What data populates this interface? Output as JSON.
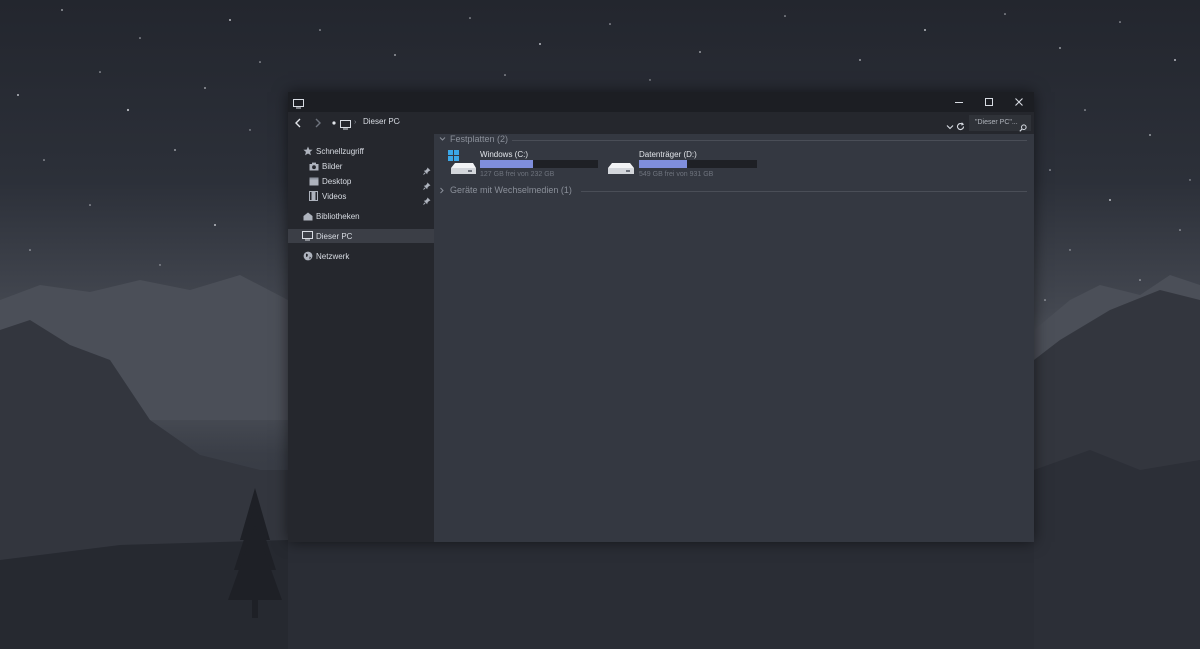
{
  "window": {
    "accent_color": "#7f8edc"
  },
  "address": {
    "breadcrumb": "Dieser PC",
    "search_placeholder": "\"Dieser PC\"..."
  },
  "sidebar": {
    "quick_access": "Schnellzugriff",
    "items": [
      {
        "label": "Bilder",
        "icon": "camera-icon",
        "pinned": true
      },
      {
        "label": "Desktop",
        "icon": "desktop-folder-icon",
        "pinned": true
      },
      {
        "label": "Videos",
        "icon": "film-icon",
        "pinned": true
      }
    ],
    "libraries": "Bibliotheken",
    "this_pc": "Dieser PC",
    "network": "Netzwerk"
  },
  "content": {
    "groups": [
      {
        "label": "Festplatten (2)",
        "expanded": true
      },
      {
        "label": "Geräte mit Wechselmedien (1)",
        "expanded": false
      }
    ],
    "drives": [
      {
        "name": "Windows (C:)",
        "free_text": "127 GB frei von 232 GB",
        "used_fraction": 0.45,
        "icon": "windows-drive-icon"
      },
      {
        "name": "Datenträger (D:)",
        "free_text": "549 GB frei von 931 GB",
        "used_fraction": 0.41,
        "icon": "hard-drive-icon"
      }
    ]
  }
}
